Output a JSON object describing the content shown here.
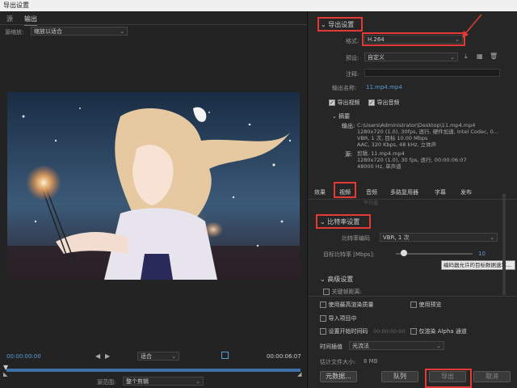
{
  "window": {
    "title": "导出设置"
  },
  "left": {
    "tabs": [
      {
        "label": "源"
      },
      {
        "label": "输出"
      }
    ],
    "source_scaling": {
      "label": "源缩放:",
      "value": "缩放以适合"
    },
    "timecode_start": "00:00:00:00",
    "timecode_end": "00:00:06:07",
    "fit": {
      "value": "适合"
    },
    "source_range": {
      "label": "源范围:",
      "value": "整个剪辑"
    }
  },
  "export_settings": {
    "title": "导出设置",
    "format": {
      "label": "格式:",
      "value": "H.264"
    },
    "preset": {
      "label": "预设:",
      "value": "自定义"
    },
    "comment": {
      "label": "注释:",
      "value": ""
    },
    "output_name": {
      "label": "输出名称:",
      "value": "11.mp4.mp4"
    },
    "export_video": {
      "label": "导出视频",
      "checked": true
    },
    "export_audio": {
      "label": "导出音频",
      "checked": true
    }
  },
  "summary": {
    "title": "摘要",
    "output_label": "输出:",
    "output_lines": [
      "C:\\Users\\Administrator\\Desktop\\11.mp4.mp4",
      "1280x720 (1.0), 30fps, 逐行, 硬件加速, Intel Codec, 0...",
      "VBR, 1 次, 目标 10.00 Mbps",
      "AAC, 320 Kbps, 48  kHz, 立体声"
    ],
    "source_label": "源:",
    "source_lines": [
      "剪辑, 11.mp4.mp4",
      "1280x720 (1.0), 30 fps, 逐行, 00:00:06:07",
      "48000 Hz, 单声道"
    ]
  },
  "settings_tabs": [
    {
      "label": "效果"
    },
    {
      "label": "视频"
    },
    {
      "label": "音频"
    },
    {
      "label": "多路复用器"
    },
    {
      "label": "字幕"
    },
    {
      "label": "发布"
    }
  ],
  "faded_row": "平均值",
  "bitrate": {
    "title": "比特率设置",
    "encoding": {
      "label": "比特率编码",
      "value": "VBR, 1 次"
    },
    "target": {
      "label": "目标比特率 [Mbps]:",
      "value": "10",
      "fraction": 0.1
    },
    "tooltip": "编码器允许的目标数据速率..."
  },
  "advanced": {
    "title": "高级设置",
    "keyframe": {
      "label": "关键帧距离:"
    }
  },
  "bottom": {
    "max_render_quality": {
      "label": "使用最高渲染质量",
      "checked": false
    },
    "use_previews": {
      "label": "使用预览",
      "checked": false
    },
    "import_into_project": {
      "label": "导入项目中",
      "checked": false
    },
    "set_start_timecode": {
      "label": "设置开始时间码",
      "value": "00:00:00:00",
      "checked": false
    },
    "render_alpha_only": {
      "label": "仅渲染 Alpha 通道",
      "checked": false
    },
    "time_interpolation": {
      "label": "时间插值",
      "value": "光流法"
    },
    "file_size": {
      "label": "估计文件大小:",
      "value": "8 MB"
    }
  },
  "buttons": {
    "metadata": "元数据...",
    "queue": "队列",
    "export": "导出",
    "cancel": "取消"
  },
  "colors": {
    "accent": "#5b9bd5",
    "highlight": "#e53935"
  }
}
